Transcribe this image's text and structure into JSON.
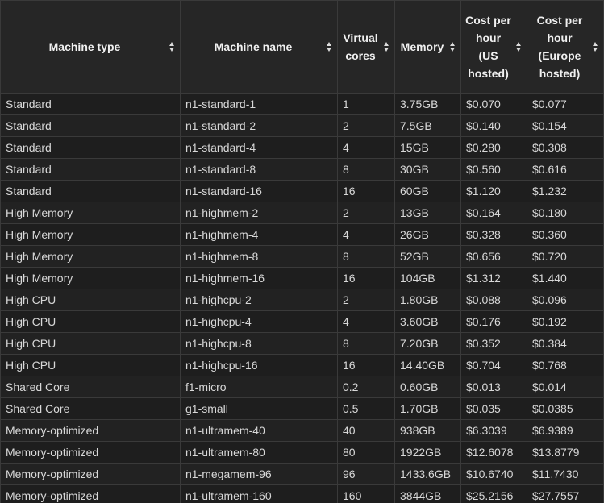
{
  "table": {
    "columns": [
      "Machine type",
      "Machine name",
      "Virtual cores",
      "Memory",
      "Cost per hour (US hosted)",
      "Cost per hour (Europe hosted)"
    ],
    "rows": [
      [
        "Standard",
        "n1-standard-1",
        "1",
        "3.75GB",
        "$0.070",
        "$0.077"
      ],
      [
        "Standard",
        "n1-standard-2",
        "2",
        "7.5GB",
        "$0.140",
        "$0.154"
      ],
      [
        "Standard",
        "n1-standard-4",
        "4",
        "15GB",
        "$0.280",
        "$0.308"
      ],
      [
        "Standard",
        "n1-standard-8",
        "8",
        "30GB",
        "$0.560",
        "$0.616"
      ],
      [
        "Standard",
        "n1-standard-16",
        "16",
        "60GB",
        "$1.120",
        "$1.232"
      ],
      [
        "High Memory",
        "n1-highmem-2",
        "2",
        "13GB",
        "$0.164",
        "$0.180"
      ],
      [
        "High Memory",
        "n1-highmem-4",
        "4",
        "26GB",
        "$0.328",
        "$0.360"
      ],
      [
        "High Memory",
        "n1-highmem-8",
        "8",
        "52GB",
        "$0.656",
        "$0.720"
      ],
      [
        "High Memory",
        "n1-highmem-16",
        "16",
        "104GB",
        "$1.312",
        "$1.440"
      ],
      [
        "High CPU",
        "n1-highcpu-2",
        "2",
        "1.80GB",
        "$0.088",
        "$0.096"
      ],
      [
        "High CPU",
        "n1-highcpu-4",
        "4",
        "3.60GB",
        "$0.176",
        "$0.192"
      ],
      [
        "High CPU",
        "n1-highcpu-8",
        "8",
        "7.20GB",
        "$0.352",
        "$0.384"
      ],
      [
        "High CPU",
        "n1-highcpu-16",
        "16",
        "14.40GB",
        "$0.704",
        "$0.768"
      ],
      [
        "Shared Core",
        "f1-micro",
        "0.2",
        "0.60GB",
        "$0.013",
        "$0.014"
      ],
      [
        "Shared Core",
        "g1-small",
        "0.5",
        "1.70GB",
        "$0.035",
        "$0.0385"
      ],
      [
        "Memory-optimized",
        "n1-ultramem-40",
        "40",
        "938GB",
        "$6.3039",
        "$6.9389"
      ],
      [
        "Memory-optimized",
        "n1-ultramem-80",
        "80",
        "1922GB",
        "$12.6078",
        "$13.8779"
      ],
      [
        "Memory-optimized",
        "n1-megamem-96",
        "96",
        "1433.6GB",
        "$10.6740",
        "$11.7430"
      ],
      [
        "Memory-optimized",
        "n1-ultramem-160",
        "160",
        "3844GB",
        "$25.2156",
        "$27.7557"
      ]
    ]
  },
  "icons": {
    "sort": "sort-both-icon"
  },
  "colors": {
    "background": "#1e1e1e",
    "header_background": "#262626",
    "border": "#3a3a3a",
    "text": "#dcdcdc"
  }
}
